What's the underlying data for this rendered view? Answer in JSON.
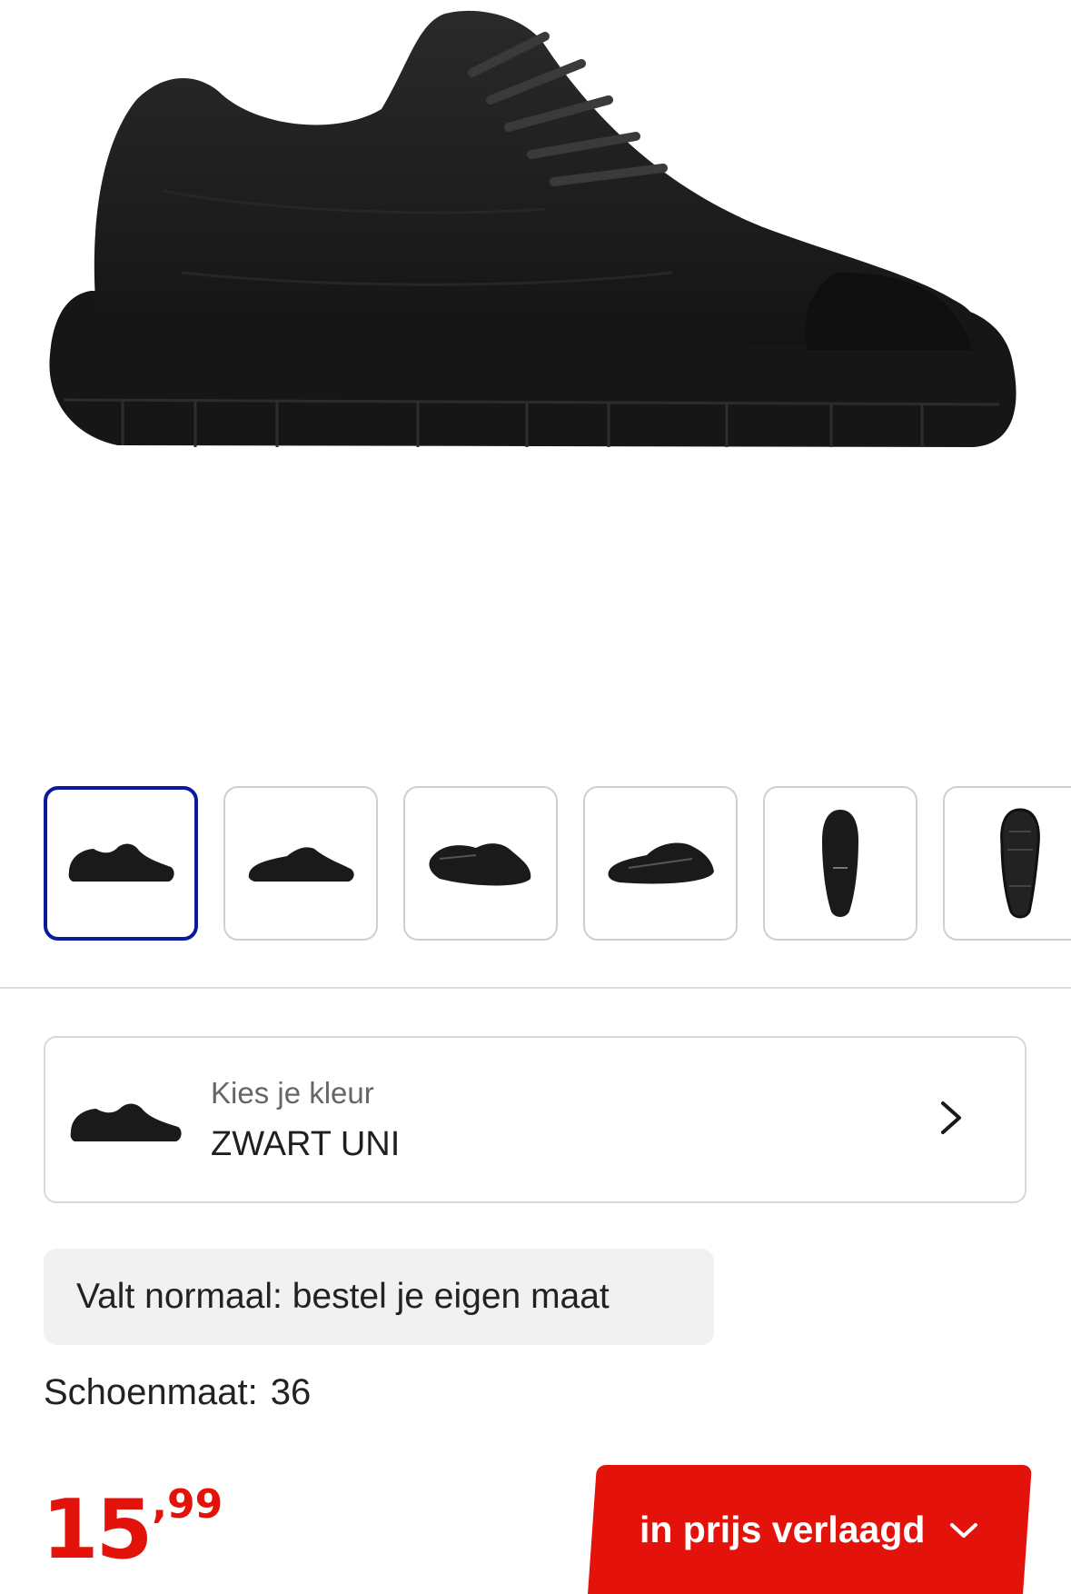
{
  "product": {
    "image_icon": "sneaker-side-image",
    "thumbnails": [
      {
        "icon": "sneaker-side-thumb",
        "active": true
      },
      {
        "icon": "sneaker-side-thumb",
        "active": false
      },
      {
        "icon": "sneaker-angle-thumb",
        "active": false
      },
      {
        "icon": "sneaker-angle-thumb",
        "active": false
      },
      {
        "icon": "sneaker-top-thumb",
        "active": false
      },
      {
        "icon": "sneaker-sole-thumb",
        "active": false
      }
    ]
  },
  "color_selector": {
    "label": "Kies je kleur",
    "value": "ZWART UNI",
    "icon": "chevron-right-icon"
  },
  "fit_note": "Valt normaal: bestel je eigen maat",
  "size": {
    "label": "Schoenmaat:",
    "value": "36"
  },
  "price": {
    "integer": "15",
    "decimal": ",99"
  },
  "cta": {
    "label": "in prijs verlaagd",
    "icon": "chevron-down-icon"
  },
  "colors": {
    "accent_red": "#e3120b",
    "active_thumb_border": "#0a1a9c"
  }
}
